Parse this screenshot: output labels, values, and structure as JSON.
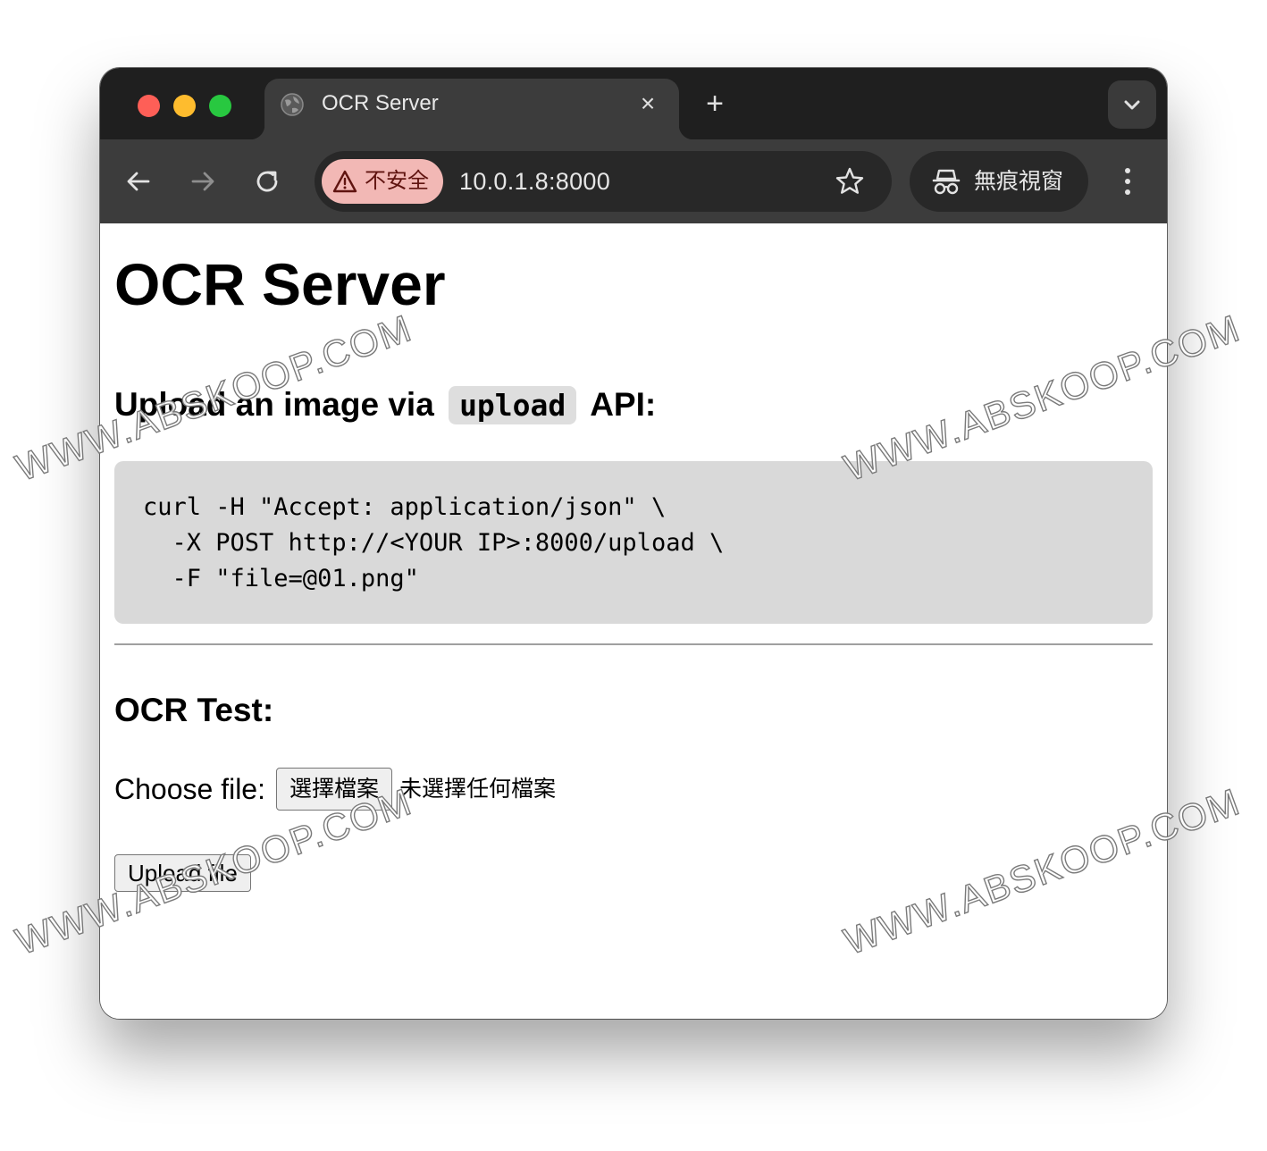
{
  "browser": {
    "tab_title": "OCR Server",
    "tab_close_icon": "×",
    "new_tab_icon": "+",
    "security_chip_label": "不安全",
    "url": "10.0.1.8:8000",
    "incognito_label": "無痕視窗",
    "colors": {
      "tabbar_bg": "#1f1f1f",
      "toolbar_bg": "#3c3c3c",
      "omnibox_bg": "#282828",
      "security_chip_bg": "#f2b8b5",
      "traffic_red": "#fe5f57",
      "traffic_yellow": "#febc2e",
      "traffic_green": "#28c840"
    }
  },
  "page": {
    "title": "OCR Server",
    "upload_heading_prefix": "Upload an image via",
    "upload_heading_code": "upload",
    "upload_heading_suffix": "API:",
    "code_block": "curl -H \"Accept: application/json\" \\\n  -X POST http://<YOUR IP>:8000/upload \\\n  -F \"file=@01.png\"",
    "test_heading": "OCR Test:",
    "choose_file_label": "Choose file:",
    "choose_file_button": "選擇檔案",
    "file_status": "未選擇任何檔案",
    "upload_button": "Upload file",
    "colors": {
      "code_block_bg": "#d9d9d9",
      "inline_code_bg": "#dedede"
    }
  },
  "watermark": {
    "text": "WWW.ABSKOOP.COM"
  }
}
